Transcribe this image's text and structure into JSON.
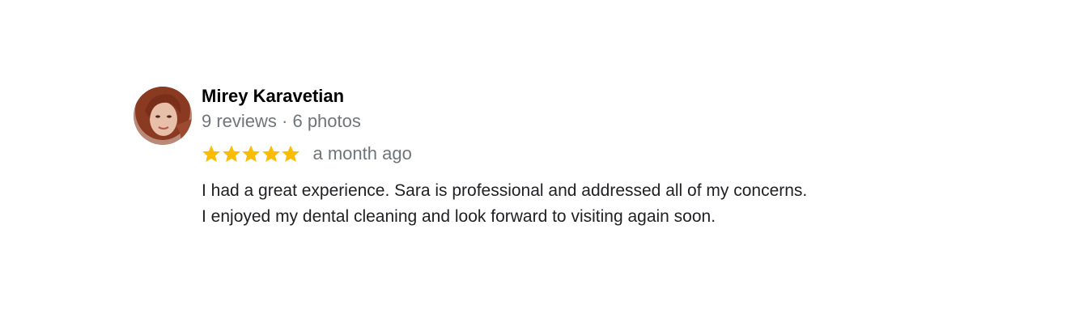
{
  "review": {
    "author": "Mirey Karavetian",
    "meta": "9 reviews · 6 photos",
    "rating": 5,
    "rating_max": 5,
    "time": "a month ago",
    "text_lines": [
      "I had a great experience. Sara is professional and addressed all of my concerns.",
      "I enjoyed my dental cleaning and look forward to visiting again soon."
    ],
    "star_color": "#fbbc04",
    "meta_color": "#70757a"
  }
}
